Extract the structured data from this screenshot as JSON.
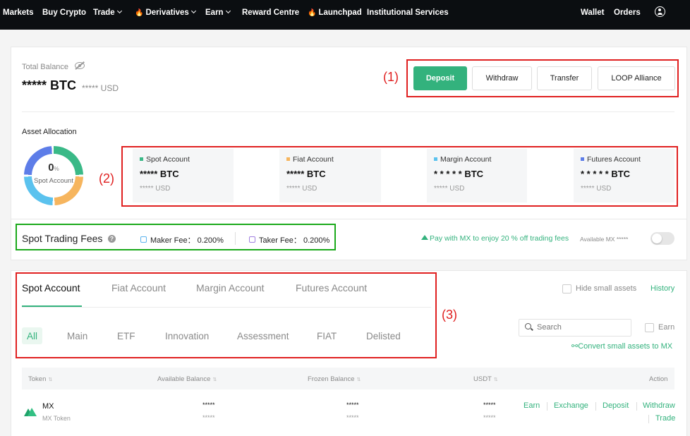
{
  "nav": {
    "items": [
      {
        "label": "Markets"
      },
      {
        "label": "Buy Crypto"
      },
      {
        "label": "Trade"
      },
      {
        "label": "Derivatives"
      },
      {
        "label": "Earn"
      },
      {
        "label": "Reward Centre"
      },
      {
        "label": "Launchpad"
      },
      {
        "label": "Institutional Services"
      }
    ],
    "wallet": "Wallet",
    "orders": "Orders"
  },
  "balance": {
    "label": "Total Balance",
    "value": "***** BTC",
    "usd": "***** USD"
  },
  "actions": {
    "deposit": "Deposit",
    "withdraw": "Withdraw",
    "transfer": "Transfer",
    "loop": "LOOP Alliance"
  },
  "annotations": {
    "a1": "(1)",
    "a2": "(2)",
    "a3": "(3)"
  },
  "allocation": {
    "label": "Asset Allocation",
    "percent": "0",
    "percent_unit": "%",
    "center_label": "Spot Account",
    "colors": {
      "spot": "#3ab987",
      "fiat": "#f6b55e",
      "margin": "#5bc2ee",
      "futures": "#5d7de8"
    },
    "accounts": [
      {
        "name": "Spot Account",
        "value": "***** BTC",
        "usd": "***** USD"
      },
      {
        "name": "Fiat Account",
        "value": "***** BTC",
        "usd": "***** USD"
      },
      {
        "name": "Margin Account",
        "value": "* * * * * BTC",
        "usd": "***** USD"
      },
      {
        "name": "Futures Account",
        "value": "* * * * * BTC",
        "usd": "***** USD"
      }
    ]
  },
  "fees": {
    "title": "Spot Trading Fees",
    "maker": "Maker Fee： 0.200%",
    "taker": "Taker Fee： 0.200%",
    "promo": "Pay with MX to enjoy 20 % off trading fees",
    "available": "Available MX *****",
    "toggle_on": false
  },
  "tabs": [
    "Spot Account",
    "Fiat Account",
    "Margin Account",
    "Futures Account"
  ],
  "subtabs": [
    "All",
    "Main",
    "ETF",
    "Innovation",
    "Assessment",
    "FIAT",
    "Delisted"
  ],
  "filters": {
    "hide_small": "Hide small assets",
    "history": "History",
    "search_placeholder": "Search",
    "earn": "Earn",
    "convert": "Convert small assets to MX"
  },
  "table": {
    "headers": {
      "token": "Token",
      "available": "Available Balance",
      "frozen": "Frozen Balance",
      "usdt": "USDT",
      "action": "Action"
    },
    "rows": [
      {
        "symbol": "MX",
        "name": "MX Token",
        "available": "*****",
        "available_sub": "*****",
        "frozen": "*****",
        "frozen_sub": "*****",
        "usdt": "*****",
        "usdt_sub": "*****",
        "actions": [
          "Earn",
          "Exchange",
          "Deposit",
          "Withdraw",
          "Trade"
        ]
      }
    ]
  }
}
